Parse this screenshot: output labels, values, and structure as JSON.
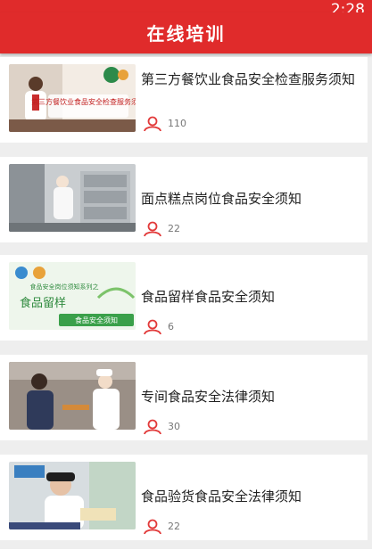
{
  "status": {
    "time": "2:28"
  },
  "header": {
    "title": "在线培训"
  },
  "accent_color": "#e02b2b",
  "courses": [
    {
      "title": "第三方餐饮业食品安全检查服务须知",
      "views": "110",
      "thumb_text": "第三方餐饮业食品安全检查服务须知"
    },
    {
      "title": "面点糕点岗位食品安全须知",
      "views": "22"
    },
    {
      "title": "食品留样食品安全须知",
      "views": "6",
      "thumb_text_1": "食品安全岗位须知系列之",
      "thumb_text_2": "食品留样",
      "thumb_text_3": "食品安全须知"
    },
    {
      "title": "专间食品安全法律须知",
      "views": "30"
    },
    {
      "title": "食品验货食品安全法律须知",
      "views": "22"
    }
  ]
}
